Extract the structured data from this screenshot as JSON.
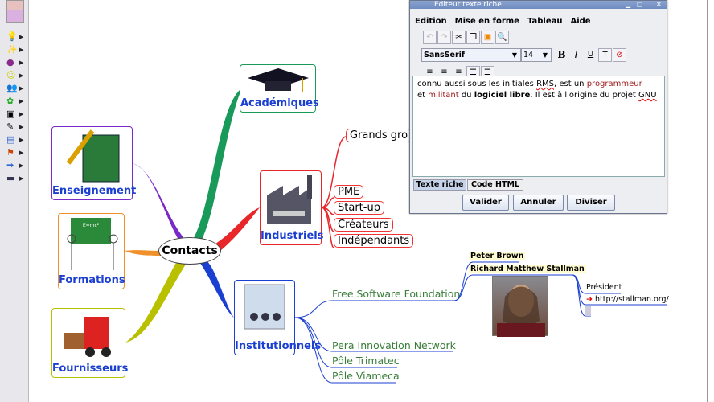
{
  "toolbar": {
    "icons": [
      "lightbulb-icon",
      "magic-wand-icon",
      "priority-1-icon",
      "smiley-icon",
      "people-icon",
      "flower-icon",
      "calendar-icon",
      "pencil-icon",
      "folder-icon",
      "flag-icon",
      "arrow-right-icon",
      "film-icon"
    ]
  },
  "map": {
    "center": "Contacts",
    "nodes": {
      "academiques": "Académiques",
      "enseignement": "Enseignement",
      "formations": "Formations",
      "fournisseurs": "Fournisseurs",
      "industriels": "Industriels",
      "institutionnels": "Institutionnels"
    },
    "industriels_children": [
      "Grands gro",
      "PME",
      "Start-up",
      "Créateurs",
      "Indépendants"
    ],
    "institutionnels_children": [
      "Free Software Foundation",
      "Pera Innovation Network",
      "Pôle Trimatec",
      "Pôle Viameca"
    ],
    "fsf_children": [
      "Peter Brown",
      "Richard Matthew Stallman"
    ],
    "rms_children": {
      "role": "Président",
      "link": "http://stallman.org/"
    },
    "formations_board_text": "E=mc²"
  },
  "dialog": {
    "title": "Editeur texte riche",
    "menu": [
      "Edition",
      "Mise en forme",
      "Tableau",
      "Aide"
    ],
    "font": "SansSerif",
    "size": "14",
    "format_buttons": [
      "B",
      "I",
      "U"
    ],
    "text": {
      "p1": "connu aussi sous les initiales ",
      "rms": "RMS",
      "p2": ", est un ",
      "prog": "programmeur",
      "p3": "et ",
      "mil": "militant",
      "p4": " du ",
      "ll": "logiciel libre",
      "p5": ". Il est à l'origine du projet ",
      "gnu": "GNU"
    },
    "tabs": [
      "Texte riche",
      "Code HTML"
    ],
    "buttons": [
      "Valider",
      "Annuler",
      "Diviser"
    ]
  },
  "colors": {
    "red_branch": "#e8262a",
    "green_branch": "#3a7d3a",
    "blue_branch": "#1a3fd1",
    "link": "#1a3fd1"
  }
}
